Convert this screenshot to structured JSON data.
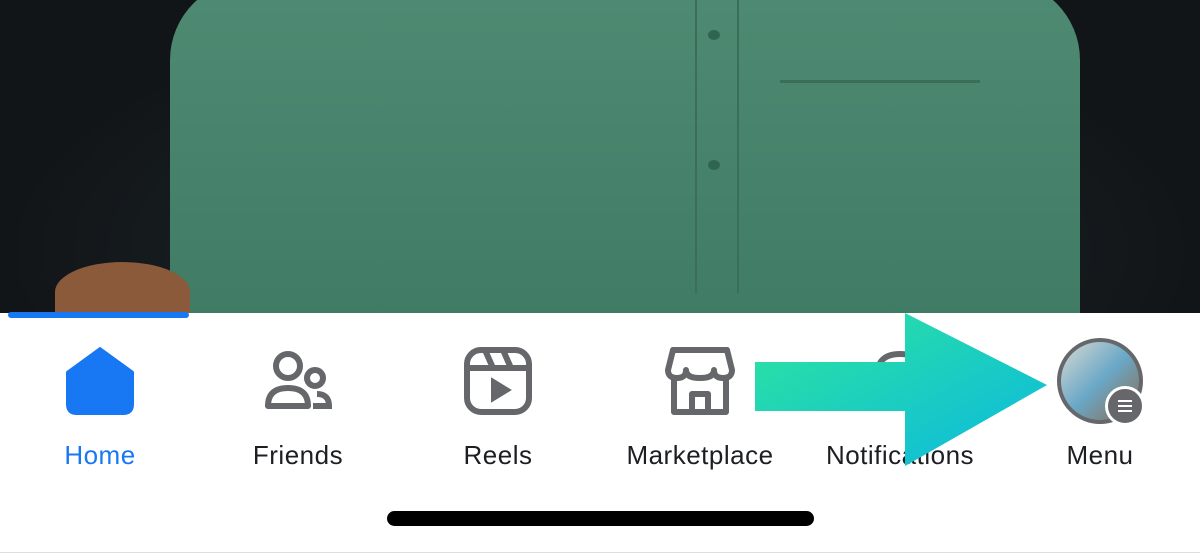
{
  "tabbar": {
    "tabs": [
      {
        "label": "Home",
        "icon": "home-icon",
        "active": true
      },
      {
        "label": "Friends",
        "icon": "friends-icon",
        "active": false
      },
      {
        "label": "Reels",
        "icon": "reels-icon",
        "active": false
      },
      {
        "label": "Marketplace",
        "icon": "marketplace-icon",
        "active": false
      },
      {
        "label": "Notifications",
        "icon": "bell-icon",
        "active": false
      },
      {
        "label": "Menu",
        "icon": "avatar-menu-icon",
        "active": false
      }
    ]
  },
  "colors": {
    "accent": "#1877f2",
    "icon_gray": "#65676b",
    "arrow_start": "#2ee59d",
    "arrow_end": "#0ab8e0"
  }
}
